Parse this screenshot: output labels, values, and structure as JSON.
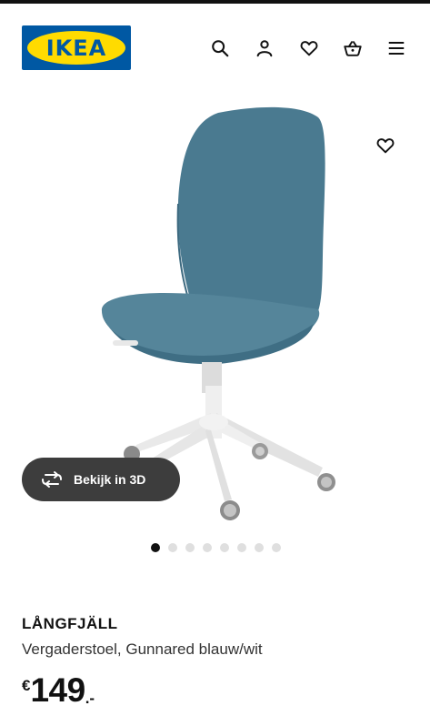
{
  "header": {
    "logo_text": "IKEA",
    "icons": [
      "search-icon",
      "user-icon",
      "heart-icon",
      "basket-icon",
      "menu-icon"
    ]
  },
  "gallery": {
    "view3d_label": "Bekijk in 3D",
    "dot_count": 8,
    "active_dot": 1,
    "chair_color": "#4a7a90"
  },
  "product": {
    "name": "LÅNGFJÄLL",
    "description": "Vergaderstoel, Gunnared blauw/wit",
    "currency": "€",
    "price": "149",
    "price_suffix": ".-"
  },
  "colors": {
    "brand_blue": "#0058a3",
    "brand_yellow": "#ffdb00",
    "pill_bg": "#3d3d3d"
  }
}
